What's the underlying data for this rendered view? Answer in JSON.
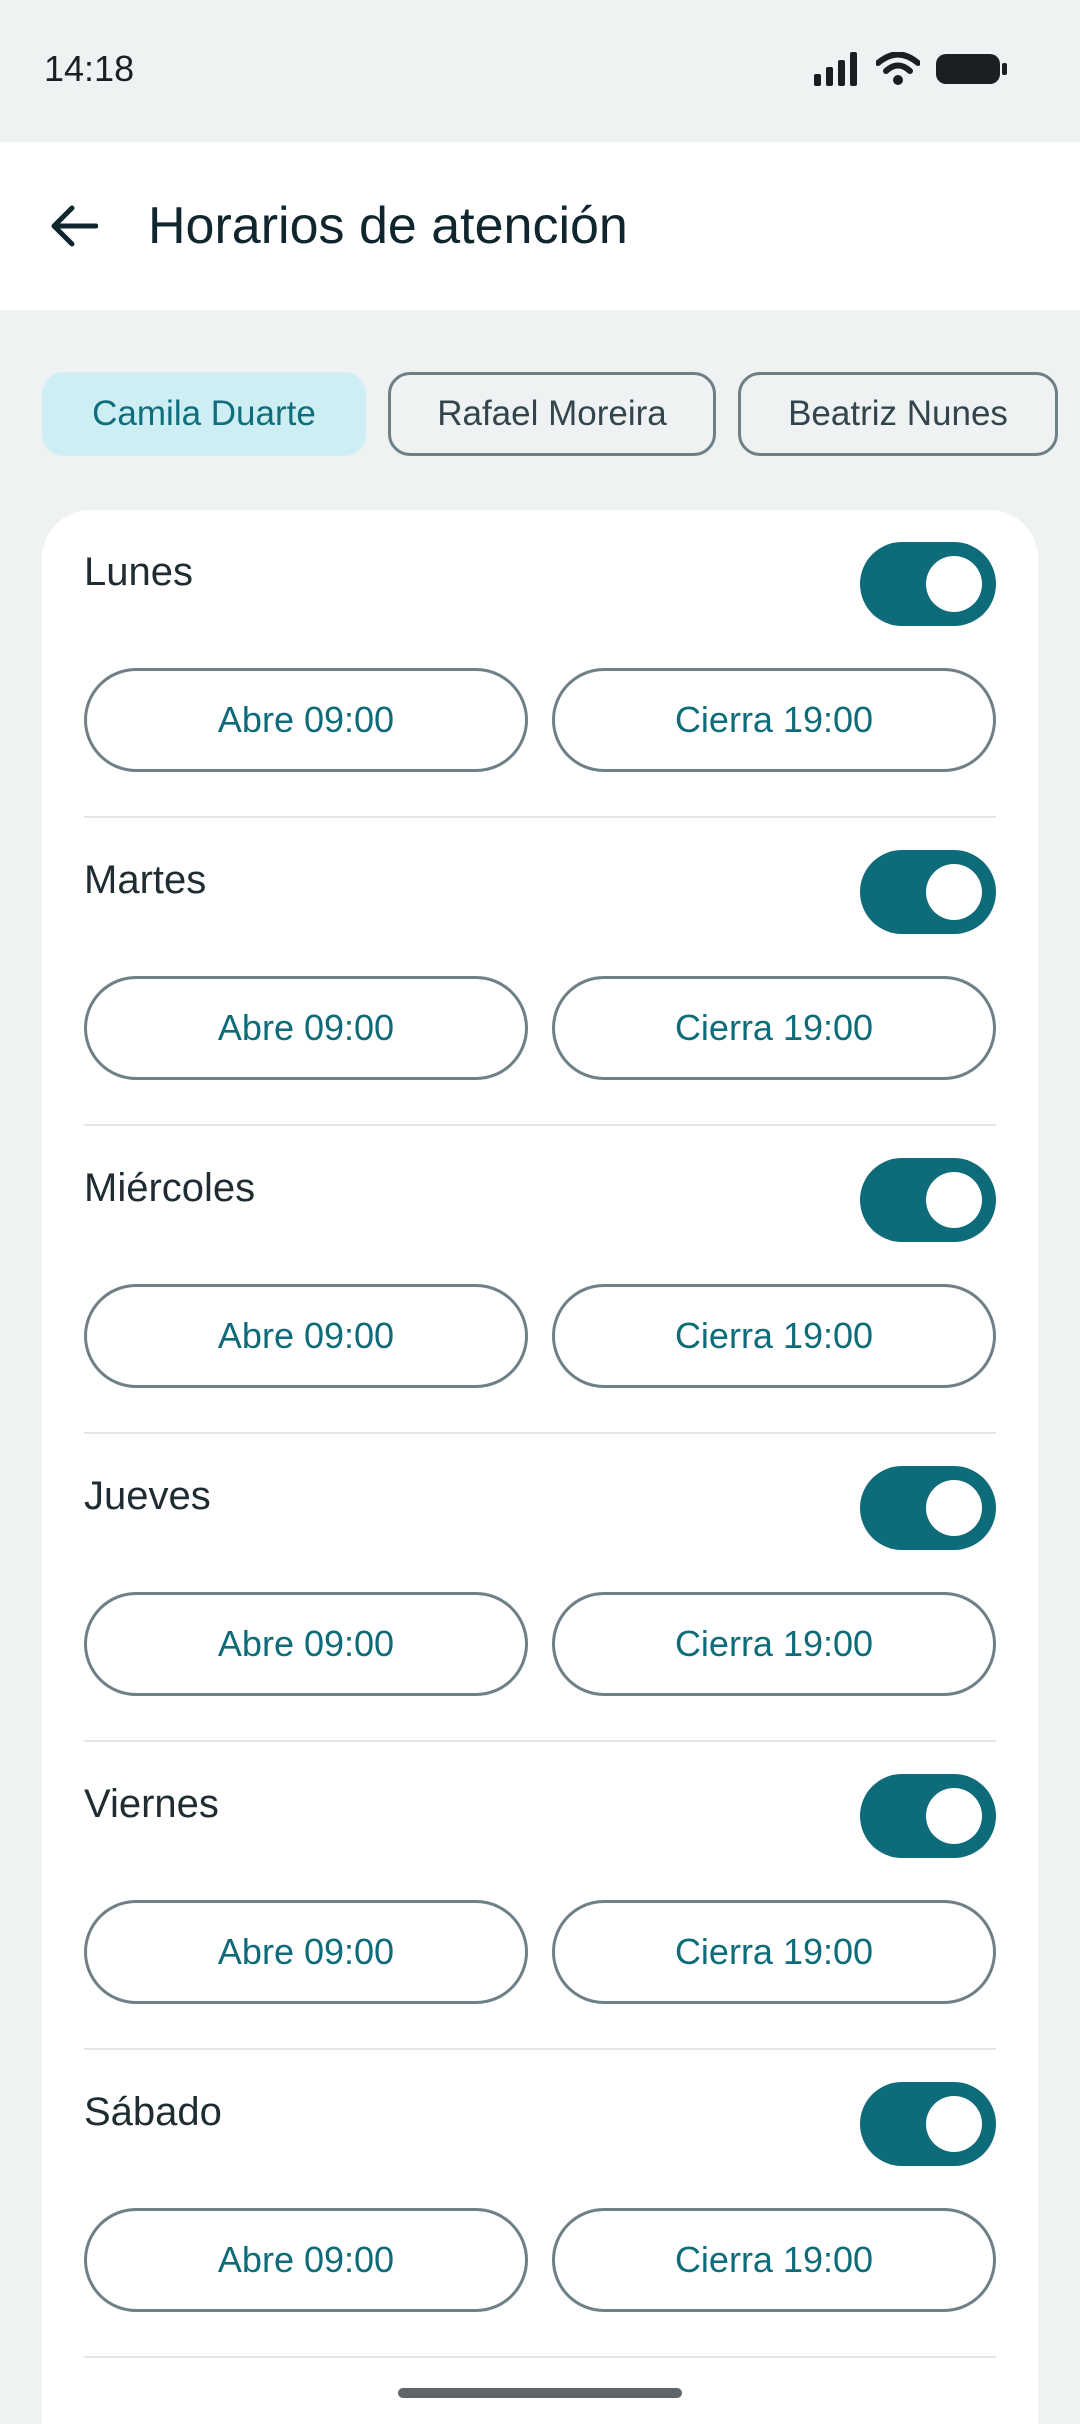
{
  "status": {
    "time": "14:18"
  },
  "header": {
    "title": "Horarios de atención"
  },
  "chips": [
    "Camila Duarte",
    "Rafael Moreira",
    "Beatriz Nunes"
  ],
  "days": [
    {
      "name": "Lunes",
      "enabled": true,
      "open": "Abre 09:00",
      "close": "Cierra 19:00"
    },
    {
      "name": "Martes",
      "enabled": true,
      "open": "Abre 09:00",
      "close": "Cierra 19:00"
    },
    {
      "name": "Miércoles",
      "enabled": true,
      "open": "Abre 09:00",
      "close": "Cierra 19:00"
    },
    {
      "name": "Jueves",
      "enabled": true,
      "open": "Abre 09:00",
      "close": "Cierra 19:00"
    },
    {
      "name": "Viernes",
      "enabled": true,
      "open": "Abre 09:00",
      "close": "Cierra 19:00"
    },
    {
      "name": "Sábado",
      "enabled": true,
      "open": "Abre 09:00",
      "close": "Cierra 19:00"
    }
  ],
  "colors": {
    "accent": "#0e6b79",
    "chip_selected_bg": "#cdeef3",
    "background": "#eef2f3"
  }
}
